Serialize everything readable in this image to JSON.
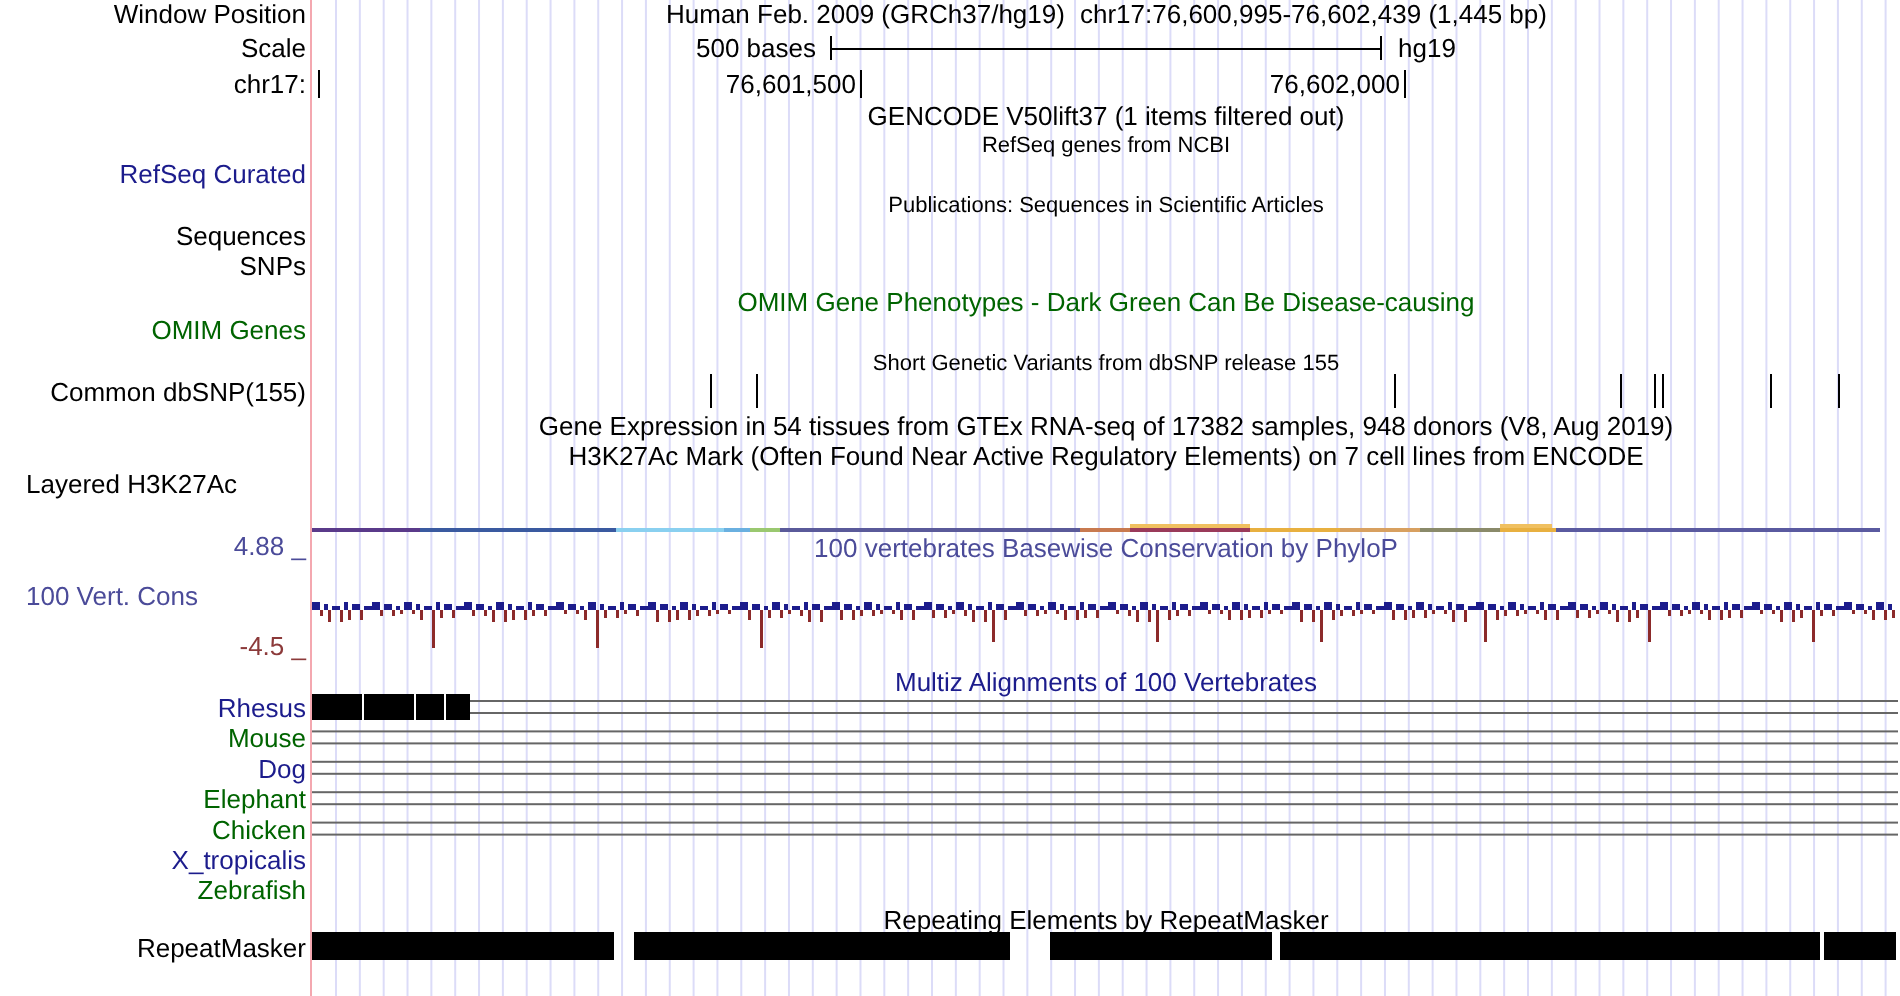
{
  "header": {
    "label": "Window Position",
    "assembly_title": "Human Feb. 2009 (GRCh37/hg19)",
    "position": "chr17:76,600,995-76,602,439 (1,445 bp)"
  },
  "scale": {
    "label": "Scale",
    "length": "500 bases",
    "assembly": "hg19"
  },
  "ruler": {
    "label": "chr17:",
    "ticks": [
      "76,601,500",
      "76,602,000"
    ]
  },
  "track_labels": [
    {
      "text": "RefSeq Curated",
      "color": "#1c1c8c"
    },
    {
      "text": "Sequences",
      "color": "#000000"
    },
    {
      "text": "SNPs",
      "color": "#000000"
    },
    {
      "text": "OMIM Genes",
      "color": "#006400"
    },
    {
      "text": "Common dbSNP(155)",
      "color": "#000000"
    },
    {
      "text": "Layered H3K27Ac",
      "color": "#000000"
    },
    {
      "text": "4.88 _",
      "color": "#4b4b99"
    },
    {
      "text": "100 Vert. Cons",
      "color": "#4b4b99"
    },
    {
      "text": "-4.5 _",
      "color": "#8c3a3a"
    },
    {
      "text": "RepeatMasker",
      "color": "#000000"
    }
  ],
  "track_titles": [
    {
      "text": "GENCODE V50lift37 (1 items filtered out)",
      "kind": "main",
      "color": "#000000"
    },
    {
      "text": "RefSeq genes from NCBI",
      "kind": "sub",
      "color": "#000000"
    },
    {
      "text": "Publications: Sequences in Scientific Articles",
      "kind": "sub",
      "color": "#000000"
    },
    {
      "text": "OMIM Gene Phenotypes - Dark Green Can Be Disease-causing",
      "kind": "main",
      "color": "#006400"
    },
    {
      "text": "Short Genetic Variants from dbSNP release 155",
      "kind": "sub",
      "color": "#000000"
    },
    {
      "text": "Gene Expression in 54 tissues from GTEx RNA-seq of 17382 samples, 948 donors (V8, Aug 2019)",
      "kind": "main",
      "color": "#000000"
    },
    {
      "text": "H3K27Ac Mark (Often Found Near Active Regulatory Elements) on 7 cell lines from ENCODE",
      "kind": "main",
      "color": "#000000"
    },
    {
      "text": "100 vertebrates Basewise Conservation by PhyloP",
      "kind": "main",
      "color": "#4b4b99"
    },
    {
      "text": "Multiz Alignments of 100 Vertebrates",
      "kind": "main",
      "color": "#1c1c8c"
    },
    {
      "text": "Repeating Elements by RepeatMasker",
      "kind": "main",
      "color": "#000000"
    }
  ],
  "multiz_species": [
    {
      "name": "Rhesus",
      "color": "#1c1c8c",
      "aligned": true
    },
    {
      "name": "Mouse",
      "color": "#006400",
      "aligned": true
    },
    {
      "name": "Dog",
      "color": "#1c1c8c",
      "aligned": true
    },
    {
      "name": "Elephant",
      "color": "#006400",
      "aligned": true
    },
    {
      "name": "Chicken",
      "color": "#006400",
      "aligned": true
    },
    {
      "name": "X_tropicalis",
      "color": "#1c1c8c",
      "aligned": false
    },
    {
      "name": "Zebrafish",
      "color": "#006400",
      "aligned": false
    }
  ]
}
